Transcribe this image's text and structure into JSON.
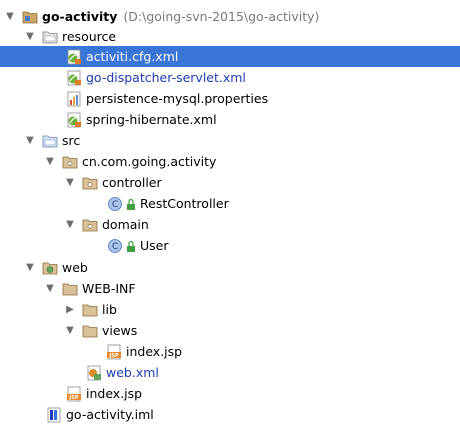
{
  "tree": {
    "project": {
      "name": "go-activity",
      "path": "(D:\\going-svn-2015\\go-activity)"
    },
    "resource": {
      "label": "resource",
      "files": [
        "activiti.cfg.xml",
        "go-dispatcher-servlet.xml",
        "persistence-mysql.properties",
        "spring-hibernate.xml"
      ]
    },
    "src": {
      "label": "src",
      "package": "cn.com.going.activity",
      "controller": {
        "label": "controller",
        "class": "RestController"
      },
      "domain": {
        "label": "domain",
        "class": "User"
      }
    },
    "web": {
      "label": "web",
      "webinf": "WEB-INF",
      "lib": "lib",
      "views": "views",
      "views_file": "index.jsp",
      "web_xml": "web.xml",
      "index": "index.jsp"
    },
    "iml": "go-activity.iml"
  },
  "colors": {
    "selection": "#3875d7",
    "modified_file": "#1f3bb3",
    "path_text": "#7a7a7a"
  }
}
